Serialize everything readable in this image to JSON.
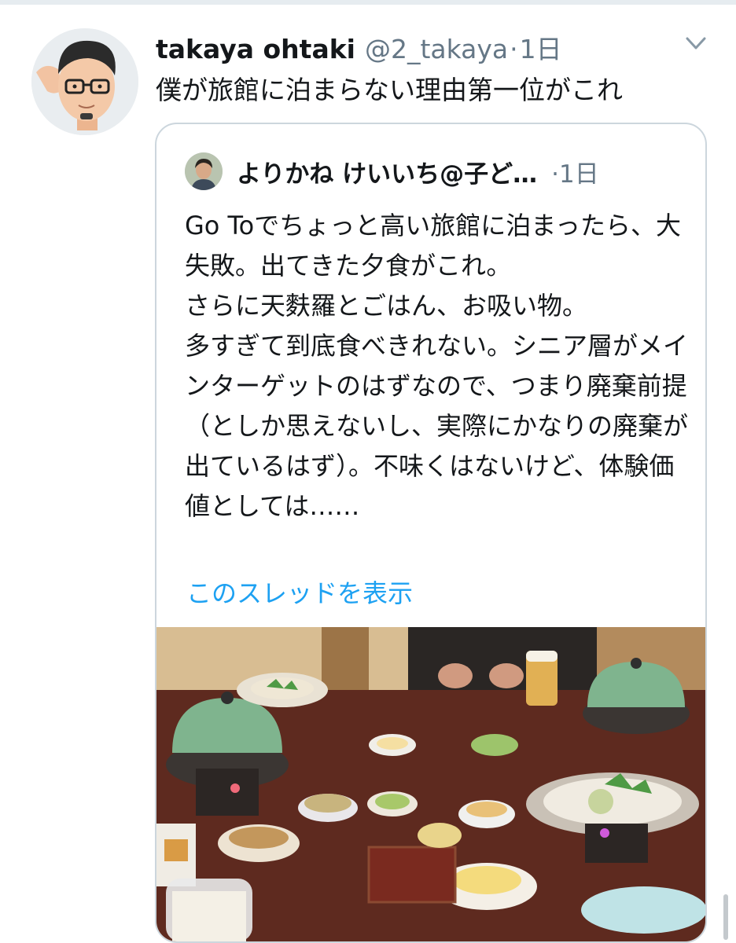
{
  "tweet": {
    "author_name": "takaya ohtaki",
    "handle": "@2_takaya",
    "separator": "·",
    "time": "1日",
    "text": "僕が旅館に泊まらない理由第一位がこれ"
  },
  "quoted": {
    "author_name": "よりかね けいいち@子ど…",
    "separator": "·",
    "time": "1日",
    "text": "Go Toでちょっと高い旅館に泊まったら、大失敗。出てきた夕食がこれ。\nさらに天麩羅とごはん、お吸い物。\n多すぎて到底食べきれない。シニア層がメインターゲットのはずなので、つまり廃棄前提（としか思えないし、実際にかなりの廃棄が出ているはず）。不味くはないけど、体験価値としては……",
    "show_thread": "このスレッドを表示"
  },
  "icons": {
    "menu": "chevron-down-icon",
    "avatar": "memoji-avatar",
    "quoted_avatar": "profile-photo"
  },
  "colors": {
    "secondary_text": "#657786",
    "link": "#1da1f2",
    "border": "#ccd6dd"
  }
}
